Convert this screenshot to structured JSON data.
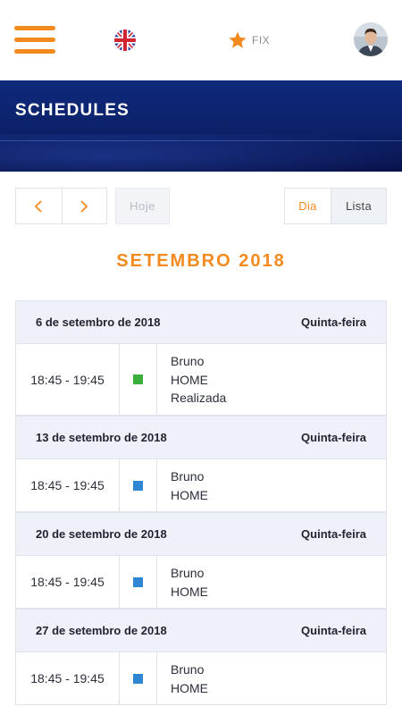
{
  "topbar": {
    "menu_icon": "hamburger-icon",
    "language_icon": "uk-flag-icon",
    "fix_icon": "star-icon",
    "fix_label": "FIX",
    "avatar_icon": "user-avatar"
  },
  "header": {
    "title": "SCHEDULES"
  },
  "controls": {
    "prev_icon": "chevron-left-icon",
    "next_icon": "chevron-right-icon",
    "today_label": "Hoje",
    "view_day_label": "Dia",
    "view_list_label": "Lista"
  },
  "month_title": "SETEMBRO 2018",
  "days": [
    {
      "date": "6 de setembro de 2018",
      "weekday": "Quinta-feira",
      "events": [
        {
          "time": "18:45 - 19:45",
          "color": "#3cae3c",
          "name": "Bruno",
          "location": "HOME",
          "status": "Realizada"
        }
      ]
    },
    {
      "date": "13 de setembro de 2018",
      "weekday": "Quinta-feira",
      "events": [
        {
          "time": "18:45 - 19:45",
          "color": "#2f87d4",
          "name": "Bruno",
          "location": "HOME"
        }
      ]
    },
    {
      "date": "20 de setembro de 2018",
      "weekday": "Quinta-feira",
      "events": [
        {
          "time": "18:45 - 19:45",
          "color": "#2f87d4",
          "name": "Bruno",
          "location": "HOME"
        }
      ]
    },
    {
      "date": "27 de setembro de 2018",
      "weekday": "Quinta-feira",
      "events": [
        {
          "time": "18:45 - 19:45",
          "color": "#2f87d4",
          "name": "Bruno",
          "location": "HOME"
        }
      ]
    }
  ],
  "colors": {
    "accent": "#f28a1e",
    "band": "#0c2168",
    "completed": "#3cae3c",
    "scheduled": "#2f87d4"
  }
}
